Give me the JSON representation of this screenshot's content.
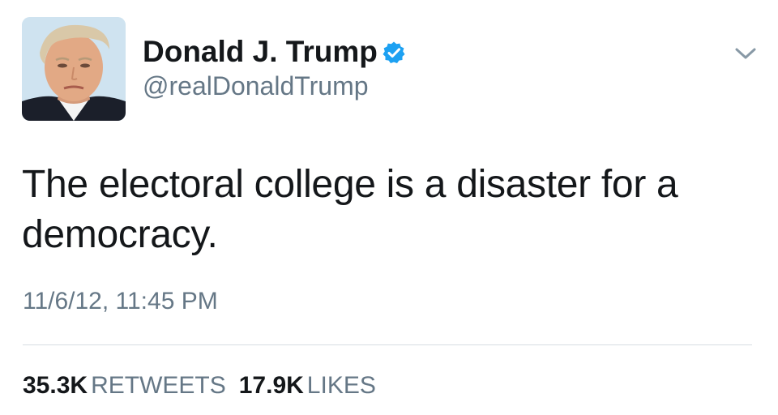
{
  "user": {
    "display_name": "Donald J. Trump",
    "handle": "@realDonaldTrump",
    "verified": true
  },
  "tweet": {
    "text": "The electoral college is a disaster for a democracy.",
    "timestamp": "11/6/12, 11:45 PM"
  },
  "stats": {
    "retweets_count": "35.3K",
    "retweets_label": "RETWEETS",
    "likes_count": "17.9K",
    "likes_label": "LIKES"
  },
  "icons": {
    "verified": "verified-badge-icon",
    "menu": "chevron-down-icon"
  },
  "colors": {
    "text_primary": "#14171a",
    "text_secondary": "#657786",
    "verified_blue": "#1da1f2",
    "divider": "#d6dde3"
  }
}
